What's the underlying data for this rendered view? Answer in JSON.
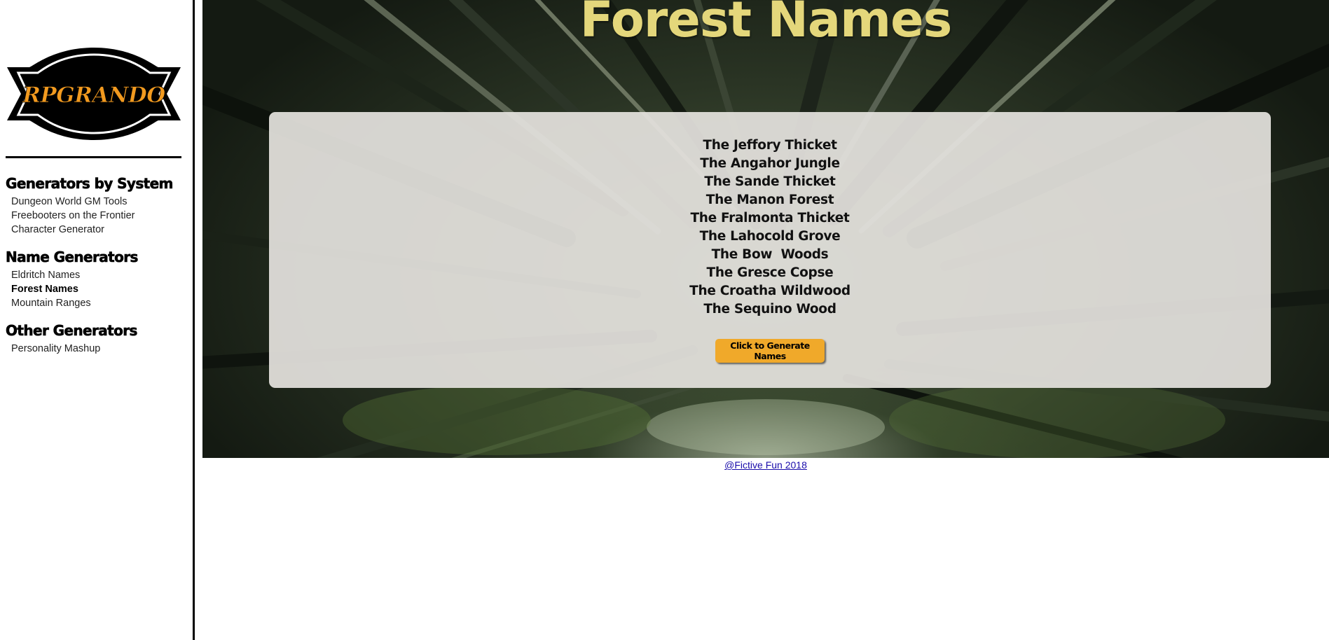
{
  "logo": {
    "text": "RPGRANDO",
    "colors": {
      "badge": "#000000",
      "text": "#f29a1f",
      "outline": "#ffffff"
    }
  },
  "sidebar": {
    "sections": [
      {
        "heading": "Generators by System",
        "items": [
          {
            "label": "Dungeon World GM Tools",
            "active": false
          },
          {
            "label": "Freebooters on the Frontier",
            "active": false
          },
          {
            "label": "Character Generator",
            "active": false
          }
        ]
      },
      {
        "heading": "Name Generators",
        "items": [
          {
            "label": "Eldritch Names",
            "active": false
          },
          {
            "label": "Forest Names",
            "active": true
          },
          {
            "label": "Mountain Ranges",
            "active": false
          }
        ]
      },
      {
        "heading": "Other Generators",
        "items": [
          {
            "label": "Personality Mashup",
            "active": false
          }
        ]
      }
    ]
  },
  "main": {
    "title": "Forest Names",
    "names": [
      "The Jeffory Thicket",
      "The Angahor Jungle",
      "The Sande Thicket",
      "The Manon Forest",
      "The Fralmonta Thicket",
      "The Lahocold Grove",
      "The Bow  Woods",
      "The Gresce Copse",
      "The Croatha Wildwood",
      "The Sequino Wood"
    ],
    "generate_button": "Click to Generate Names"
  },
  "footer": {
    "link_text": "@Fictive Fun 2018"
  },
  "colors": {
    "title": "#e4d77b",
    "button": "#f0a92a",
    "panel": "#e4e2de",
    "link": "#1a0dab"
  }
}
